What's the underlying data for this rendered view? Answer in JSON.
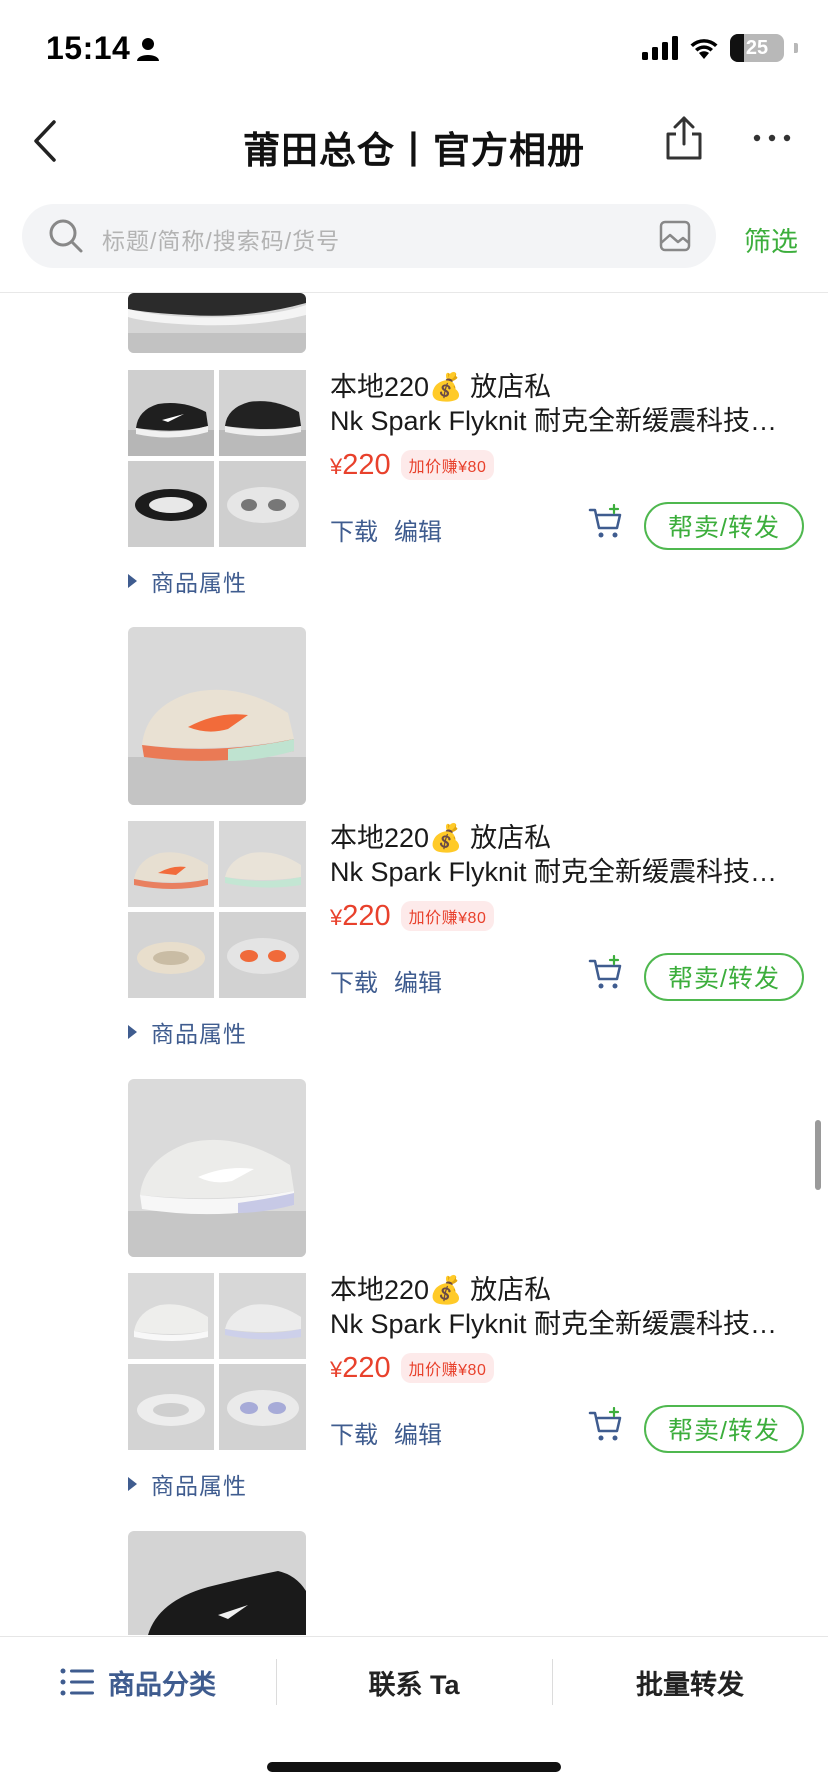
{
  "status_bar": {
    "time": "15:14",
    "battery": "25"
  },
  "nav": {
    "title": "莆田总仓丨官方相册"
  },
  "search": {
    "placeholder": "标题/简称/搜索码/货号",
    "filter_label": "筛选"
  },
  "products": [
    {
      "line1": "本地220💰 放店私",
      "line2": "Nk Spark Flyknit 耐克全新缓震科技休闲运动跑步鞋",
      "price_symbol": "¥",
      "price": "220",
      "earn": "加价赚¥80",
      "download": "下载",
      "edit": "编辑",
      "share": "帮卖/转发",
      "attributes": "商品属性",
      "colorway": "black"
    },
    {
      "line1": "本地220💰 放店私",
      "line2": "Nk Spark Flyknit 耐克全新缓震科技休闲运动跑步鞋",
      "price_symbol": "¥",
      "price": "220",
      "earn": "加价赚¥80",
      "download": "下载",
      "edit": "编辑",
      "share": "帮卖/转发",
      "attributes": "商品属性",
      "colorway": "cream-orange"
    },
    {
      "line1": "本地220💰 放店私",
      "line2": "Nk Spark Flyknit 耐克全新缓震科技休闲运动跑步鞋",
      "price_symbol": "¥",
      "price": "220",
      "earn": "加价赚¥80",
      "download": "下载",
      "edit": "编辑",
      "share": "帮卖/转发",
      "attributes": "商品属性",
      "colorway": "white-grey"
    }
  ],
  "bottom_bar": {
    "categories": "商品分类",
    "contact": "联系 Ta",
    "batch": "批量转发"
  },
  "colors": {
    "accent_green": "#3cae3c",
    "price_red": "#e8412c",
    "link_blue": "#3f5c8f"
  }
}
